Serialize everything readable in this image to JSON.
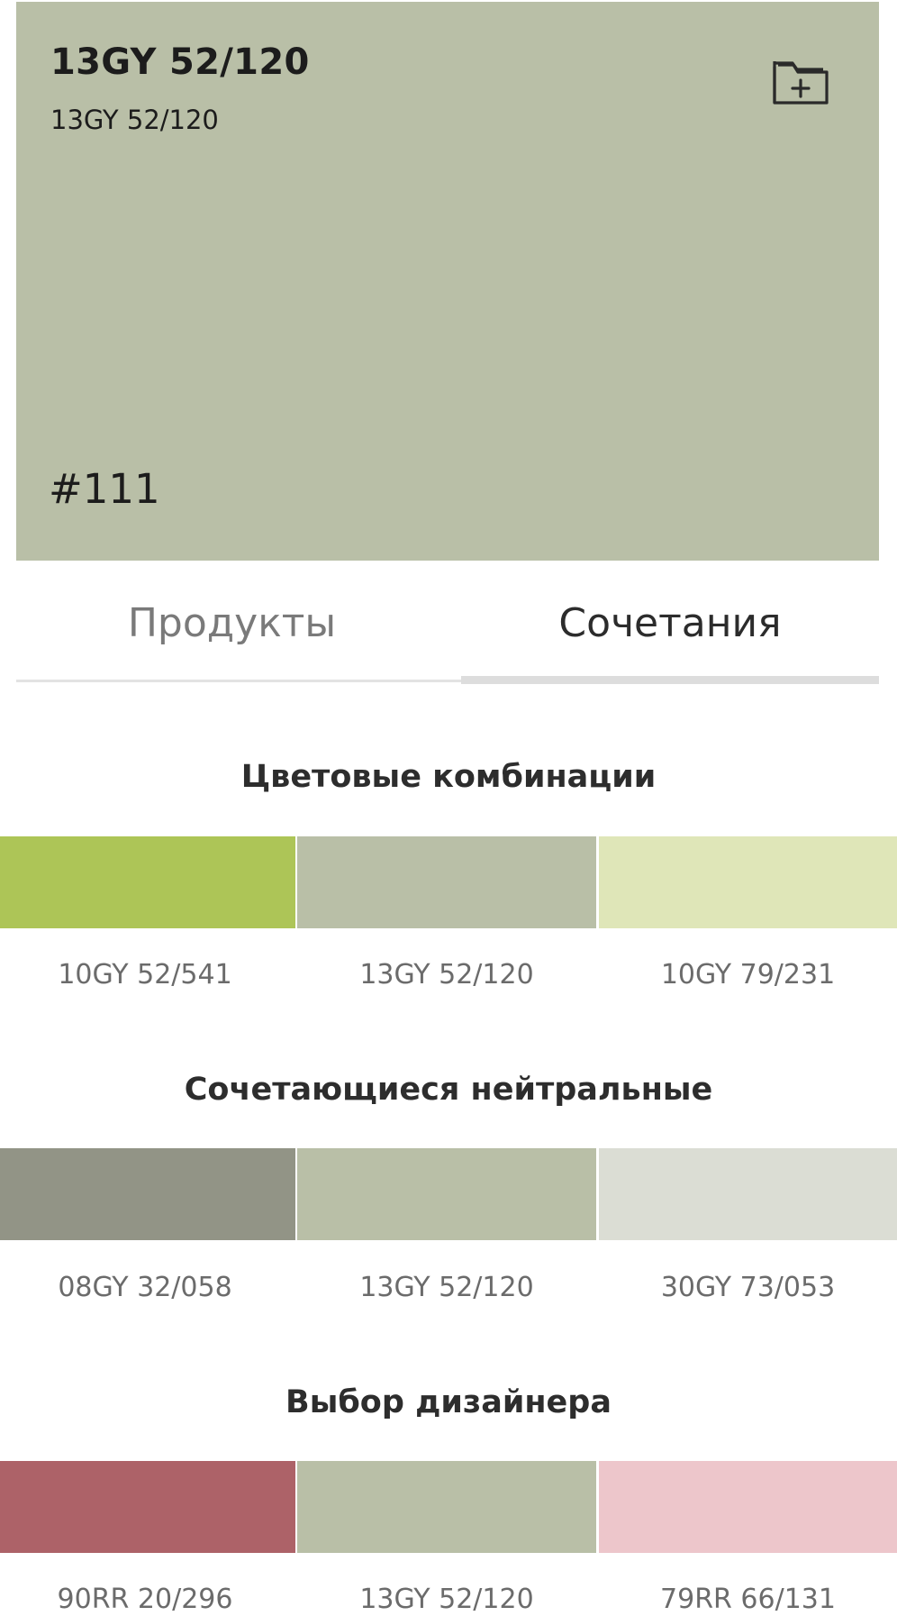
{
  "hero": {
    "title": "13GY 52/120",
    "subtitle": "13GY 52/120",
    "code": "#111",
    "background": "#b9bfa7",
    "icon": "folder-plus-icon"
  },
  "tabs": {
    "products": "Продукты",
    "combinations": "Сочетания",
    "active": "combinations"
  },
  "sections": [
    {
      "title": "Цветовые комбинации",
      "swatches": [
        {
          "label": "10GY 52/541",
          "color": "#adc557"
        },
        {
          "label": "13GY 52/120",
          "color": "#b9bfa7"
        },
        {
          "label": "10GY 79/231",
          "color": "#dfe6b8"
        }
      ]
    },
    {
      "title": "Сочетающиеся нейтральные",
      "swatches": [
        {
          "label": "08GY 32/058",
          "color": "#929486"
        },
        {
          "label": "13GY 52/120",
          "color": "#b9bfa7"
        },
        {
          "label": "30GY 73/053",
          "color": "#dbddd4"
        }
      ]
    },
    {
      "title": "Выбор дизайнера",
      "swatches": [
        {
          "label": "90RR 20/296",
          "color": "#ad6268"
        },
        {
          "label": "13GY 52/120",
          "color": "#b9bfa7"
        },
        {
          "label": "79RR 66/131",
          "color": "#edc6cb"
        }
      ]
    }
  ]
}
